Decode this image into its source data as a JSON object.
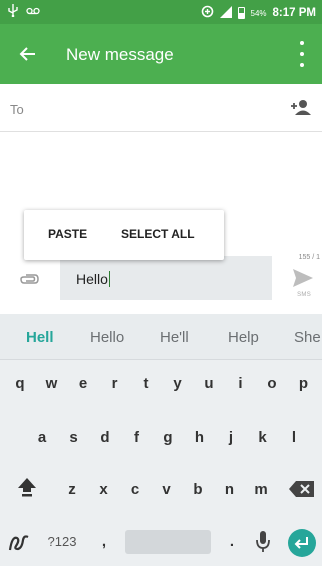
{
  "status_bar": {
    "time": "8:17 PM",
    "battery_percent": "54%",
    "left_icons": [
      "usb-icon",
      "voicemail-icon"
    ],
    "right_icons": [
      "data-saver-icon",
      "signal-icon",
      "battery-icon"
    ]
  },
  "app_bar": {
    "title": "New message",
    "back_icon": "arrow-back-icon",
    "overflow_icon": "more-vert-icon",
    "background": "#4caf50"
  },
  "recipient": {
    "label": "To",
    "value": "",
    "add_contact_icon": "person-add-icon"
  },
  "context_menu": {
    "items": [
      "PASTE",
      "SELECT ALL"
    ]
  },
  "compose": {
    "attach_icon": "attach-icon",
    "text": "Hello",
    "char_counter": "155 / 1",
    "send_icon": "send-icon",
    "send_label": "SMS"
  },
  "keyboard": {
    "suggestions": [
      "Hell",
      "Hello",
      "He'll",
      "Help",
      "She"
    ],
    "row1": [
      "q",
      "w",
      "e",
      "r",
      "t",
      "y",
      "u",
      "i",
      "o",
      "p"
    ],
    "row2": [
      "a",
      "s",
      "d",
      "f",
      "g",
      "h",
      "j",
      "k",
      "l"
    ],
    "row3": [
      "z",
      "x",
      "c",
      "v",
      "b",
      "n",
      "m"
    ],
    "symbols_label": "?123",
    "comma": ",",
    "period": ".",
    "icons": [
      "shift-icon",
      "backspace-icon",
      "gesture-icon",
      "mic-icon",
      "enter-icon"
    ],
    "accent": "#26a69a"
  }
}
